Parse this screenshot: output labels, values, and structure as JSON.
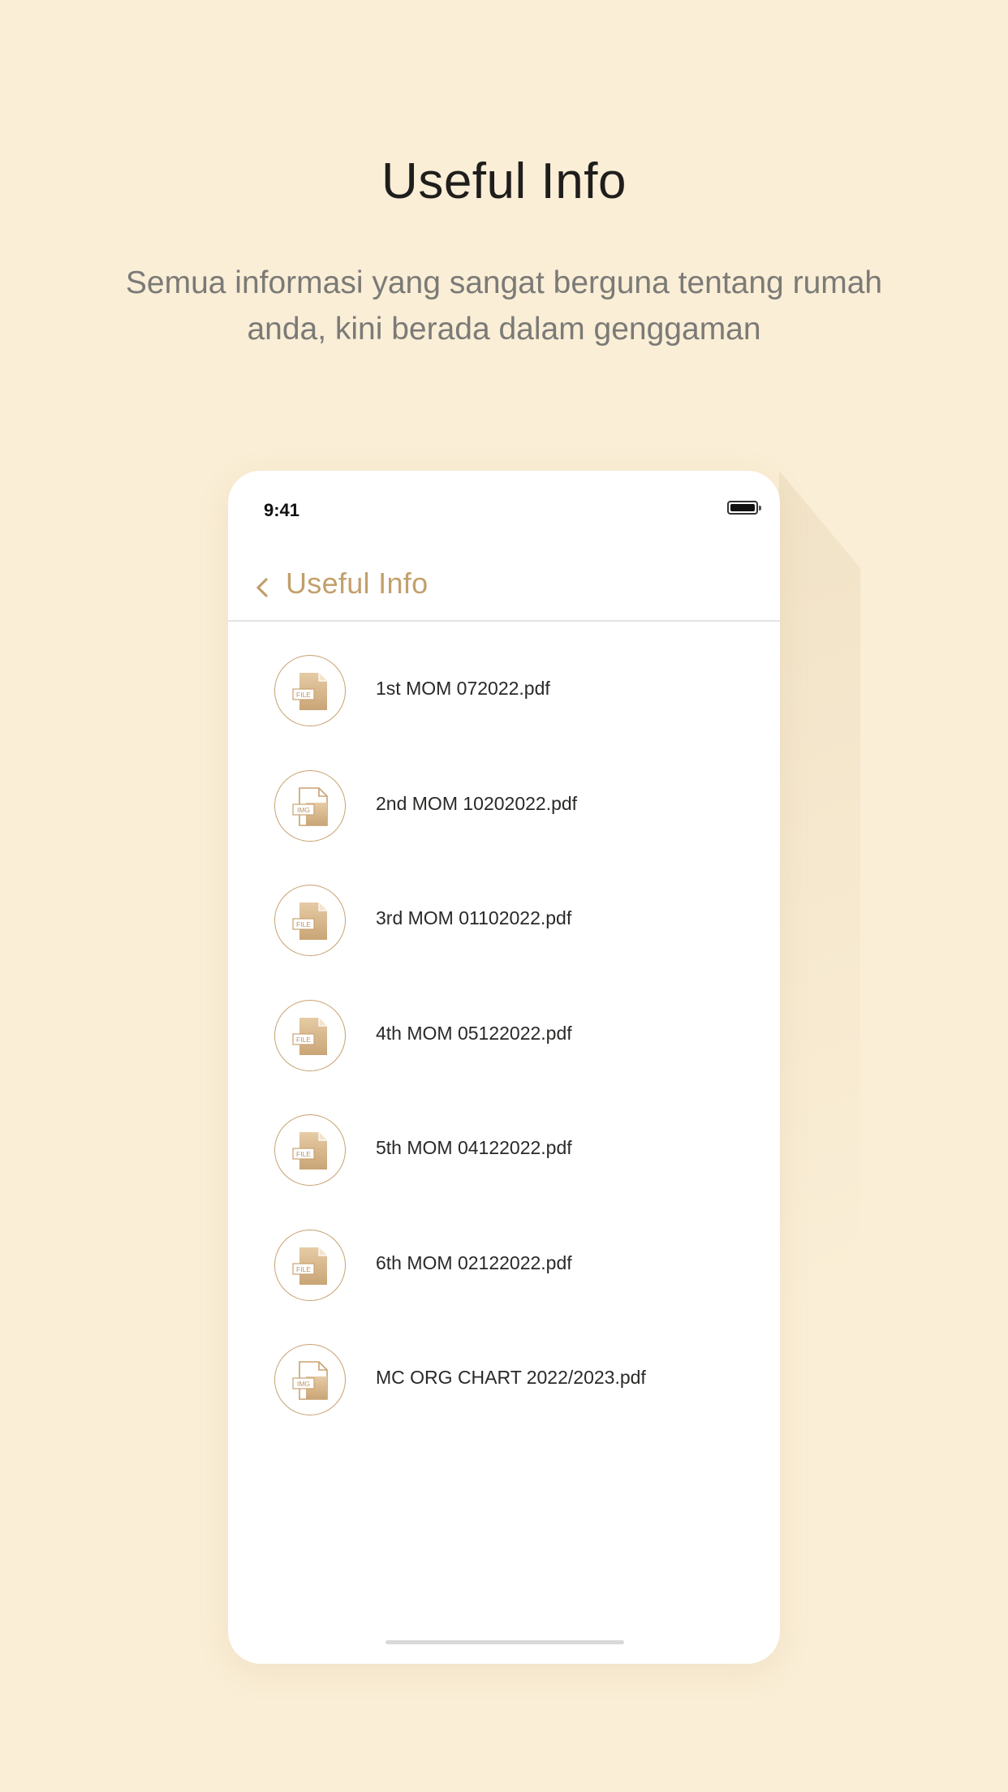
{
  "promo": {
    "title": "Useful Info",
    "subtitle": "Semua informasi yang sangat berguna tentang rumah anda, kini berada dalam genggaman"
  },
  "status_bar": {
    "time": "9:41",
    "battery_icon": "battery-icon"
  },
  "nav": {
    "back_icon": "chevron-left-icon",
    "title": "Useful Info"
  },
  "files": [
    {
      "name": "1st MOM 072022.pdf",
      "icon_label": "FILE",
      "icon": "file-icon"
    },
    {
      "name": "2nd MOM 10202022.pdf",
      "icon_label": "IMG",
      "icon": "image-file-icon"
    },
    {
      "name": "3rd MOM 01102022.pdf",
      "icon_label": "FILE",
      "icon": "file-icon"
    },
    {
      "name": "4th MOM 05122022.pdf",
      "icon_label": "FILE",
      "icon": "file-icon"
    },
    {
      "name": "5th MOM 04122022.pdf",
      "icon_label": "FILE",
      "icon": "file-icon"
    },
    {
      "name": "6th MOM 02122022.pdf",
      "icon_label": "FILE",
      "icon": "file-icon"
    },
    {
      "name": "MC ORG CHART 2022/2023.pdf",
      "icon_label": "IMG",
      "icon": "image-file-icon"
    }
  ],
  "colors": {
    "background": "#faeed6",
    "accent": "#c2a06c",
    "icon_fill": "#d8b98f"
  }
}
